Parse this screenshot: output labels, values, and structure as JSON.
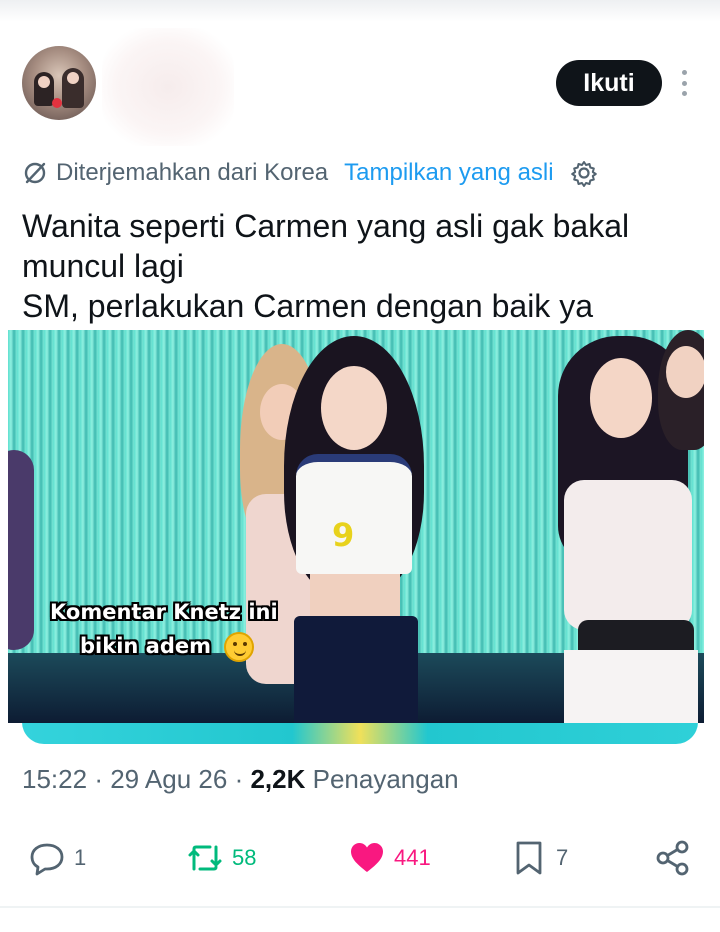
{
  "header": {
    "follow_label": "Ikuti"
  },
  "translation": {
    "translated_from": "Diterjemahkan dari Korea",
    "show_original": "Tampilkan yang asli"
  },
  "tweet": {
    "lines": [
      "Wanita seperti Carmen yang asli gak bakal",
      "muncul lagi",
      "SM, perlakukan Carmen dengan baik ya"
    ]
  },
  "media": {
    "caption_line1": "Komentar Knetz ini",
    "caption_line2": "bikin adem",
    "caption_emoji": "hugging-face-emoji",
    "shirt_number": "9"
  },
  "meta": {
    "time": "15:22",
    "date": "29 Agu 26",
    "views_count": "2,2K",
    "views_label": "Penayangan"
  },
  "actions": {
    "reply_count": "1",
    "retweet_count": "58",
    "like_count": "441",
    "bookmark_count": "7"
  },
  "colors": {
    "accent_blue": "#1d9bf0",
    "retweet_green": "#00ba7c",
    "like_pink": "#f91880",
    "muted_text": "#536471",
    "primary_text": "#0f1419"
  }
}
